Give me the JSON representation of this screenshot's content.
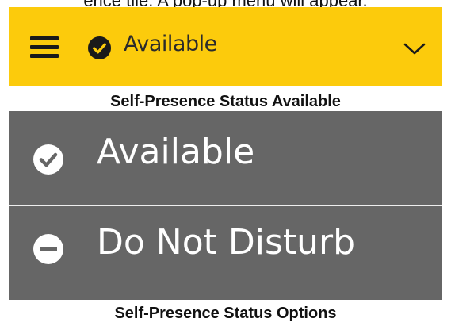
{
  "intro_text": "ence tile. A pop-up menu will appear.",
  "status_bar": {
    "status_label": "Available",
    "icons": {
      "menu": "hamburger-menu-icon",
      "status": "check-circle-icon",
      "expand": "chevron-down-icon"
    },
    "colors": {
      "background": "#fccb0c",
      "foreground": "#1a1a1a"
    }
  },
  "caption_status": "Self-Presence Status Available",
  "menu": {
    "items": [
      {
        "label": "Available",
        "icon": "check-circle-icon"
      },
      {
        "label": "Do Not Disturb",
        "icon": "minus-circle-icon"
      }
    ],
    "colors": {
      "background": "#666666",
      "text": "#ffffff",
      "divider": "#eeeeee"
    }
  },
  "caption_options": "Self-Presence Status Options"
}
